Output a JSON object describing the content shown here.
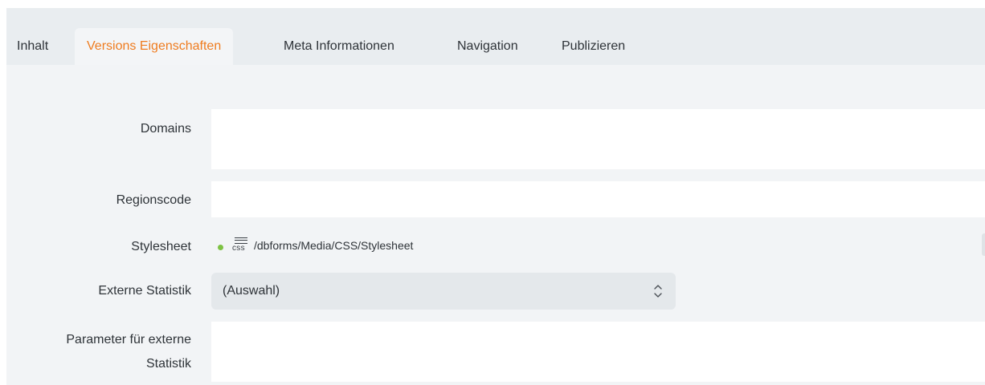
{
  "tabs": [
    {
      "label": "Inhalt",
      "active": false
    },
    {
      "label": "Versions Eigenschaften",
      "active": true
    },
    {
      "label": "Meta Informationen",
      "active": false
    },
    {
      "label": "Navigation",
      "active": false
    },
    {
      "label": "Publizieren",
      "active": false
    }
  ],
  "form": {
    "domains": {
      "label": "Domains",
      "value": ""
    },
    "regionscode": {
      "label": "Regionscode",
      "value": ""
    },
    "stylesheet": {
      "label": "Stylesheet",
      "icon": "css-file-icon",
      "icon_text": "css",
      "path": "/dbforms/Media/CSS/Stylesheet",
      "status_color": "#7dc243"
    },
    "externe_statistik": {
      "label": "Externe Statistik",
      "selected": "(Auswahl)"
    },
    "parameter": {
      "label_line1": "Parameter für externe",
      "label_line2": "Statistik",
      "value": ""
    }
  },
  "colors": {
    "accent": "#ef7c1f",
    "status_ok": "#7dc243"
  }
}
